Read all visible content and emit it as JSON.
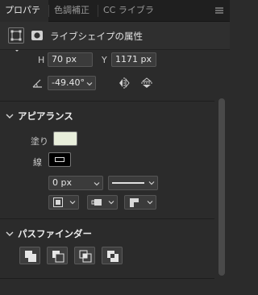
{
  "tabs": [
    {
      "label": "プロパティ"
    },
    {
      "label": "色調補正"
    },
    {
      "label": "CC ライブラリ"
    }
  ],
  "header": {
    "title": "ライブシェイプの属性"
  },
  "transform": {
    "h_label": "H",
    "h_value": "70 px",
    "y_label": "Y",
    "y_value": "1171 px",
    "angle_value": "-49.40°"
  },
  "appearance": {
    "title": "アピアランス",
    "fill_label": "塗り",
    "stroke_label": "線",
    "fill_color": "#e8eedb",
    "stroke_width": "0 px"
  },
  "pathfinder": {
    "title": "パスファインダー"
  }
}
